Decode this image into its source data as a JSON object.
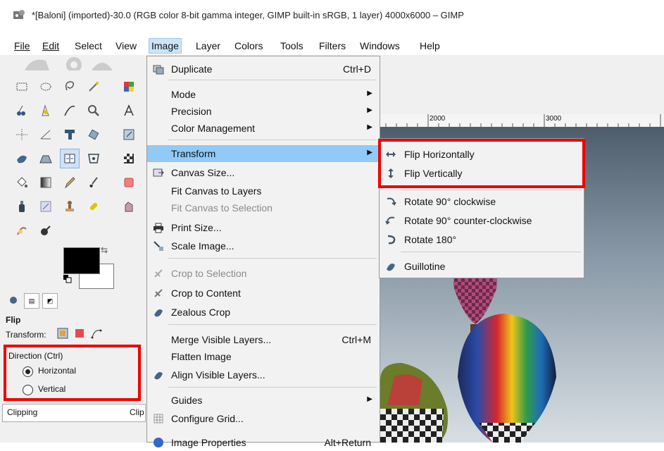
{
  "window": {
    "title": "*[Baloni] (imported)-30.0 (RGB color 8-bit gamma integer, GIMP built-in sRGB, 1 layer) 4000x6000 – GIMP"
  },
  "menubar": {
    "items": [
      "File",
      "Edit",
      "Select",
      "View",
      "Image",
      "Layer",
      "Colors",
      "Tools",
      "Filters",
      "Windows",
      "Help"
    ],
    "active": "Image"
  },
  "image_menu": {
    "items": [
      {
        "label": "Duplicate",
        "shortcut": "Ctrl+D",
        "icon": "duplicate-icon"
      },
      {
        "label": "Mode",
        "submenu": true
      },
      {
        "label": "Precision",
        "submenu": true
      },
      {
        "label": "Color Management",
        "submenu": true
      },
      {
        "label": "Transform",
        "submenu": true,
        "highlighted": true
      },
      {
        "label": "Canvas Size...",
        "icon": "canvas-size-icon"
      },
      {
        "label": "Fit Canvas to Layers"
      },
      {
        "label": "Fit Canvas to Selection",
        "disabled": true
      },
      {
        "label": "Print Size...",
        "icon": "printer-icon"
      },
      {
        "label": "Scale Image...",
        "icon": "scale-icon"
      },
      {
        "label": "Crop to Selection",
        "disabled": true,
        "icon": "crop-icon"
      },
      {
        "label": "Crop to Content",
        "icon": "crop-icon"
      },
      {
        "label": "Zealous Crop",
        "icon": "zealous-crop-icon"
      },
      {
        "label": "Merge Visible Layers...",
        "shortcut": "Ctrl+M"
      },
      {
        "label": "Flatten Image"
      },
      {
        "label": "Align Visible Layers...",
        "icon": "align-icon"
      },
      {
        "label": "Guides",
        "submenu": true
      },
      {
        "label": "Configure Grid...",
        "icon": "grid-icon"
      },
      {
        "label": "Image Properties",
        "shortcut": "Alt+Return"
      }
    ]
  },
  "transform_submenu": {
    "items": [
      {
        "label": "Flip Horizontally",
        "icon": "flip-horizontal-icon"
      },
      {
        "label": "Flip Vertically",
        "icon": "flip-vertical-icon"
      },
      {
        "label": "Rotate 90° clockwise",
        "icon": "rotate-cw-icon"
      },
      {
        "label": "Rotate 90° counter-clockwise",
        "icon": "rotate-ccw-icon"
      },
      {
        "label": "Rotate 180°",
        "icon": "rotate-180-icon"
      },
      {
        "label": "Guillotine",
        "icon": "guillotine-icon"
      }
    ]
  },
  "ruler": {
    "labels": [
      "2000",
      "3000"
    ]
  },
  "tool_options": {
    "title": "Flip",
    "transform_label": "Transform:",
    "direction_label": "Direction  (Ctrl)",
    "options": [
      "Horizontal",
      "Vertical"
    ],
    "selected": "Horizontal",
    "clipping_label": "Clipping",
    "clipping_value": "Clip"
  },
  "colors": {
    "foreground": "#000000",
    "background": "#ffffff",
    "highlight": "#91c9f7",
    "annotation": "#e00000"
  }
}
